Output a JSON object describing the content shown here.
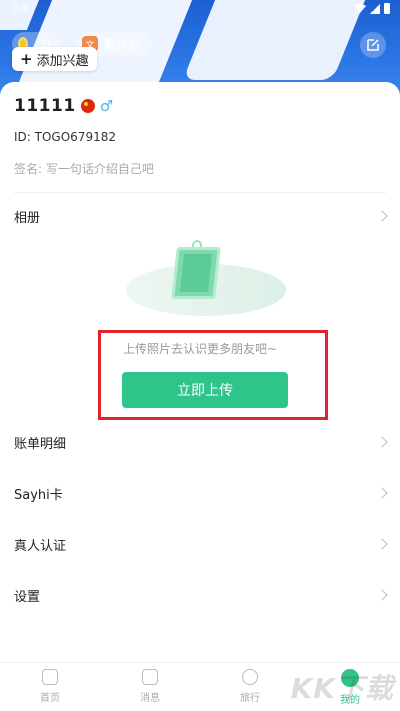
{
  "status_bar": {
    "time": "3:3"
  },
  "header": {
    "coin_count": "0",
    "translate_label": "翻译包",
    "add_interest_label": "添加兴趣"
  },
  "profile": {
    "name": "11111",
    "id_label": "ID:",
    "id_value": "TOGO679182",
    "signature_label": "签名:",
    "signature_placeholder": "写一句话介绍自己吧"
  },
  "album": {
    "label": "相册",
    "hint": "上传照片去认识更多朋友吧~",
    "upload_button": "立即上传"
  },
  "menu": [
    {
      "label": "账单明细"
    },
    {
      "label": "Sayhi卡"
    },
    {
      "label": "真人认证"
    },
    {
      "label": "设置"
    }
  ],
  "tabbar": [
    {
      "label": "首页",
      "icon": "home-icon"
    },
    {
      "label": "消息",
      "icon": "message-icon"
    },
    {
      "label": "旅行",
      "icon": "navigate-icon"
    },
    {
      "label": "我的",
      "icon": "profile-icon",
      "active": true
    }
  ],
  "watermark": "KK下载",
  "colors": {
    "accent": "#2fc48a",
    "highlight_box": "#e0242c",
    "banner": "#2a74e4"
  }
}
